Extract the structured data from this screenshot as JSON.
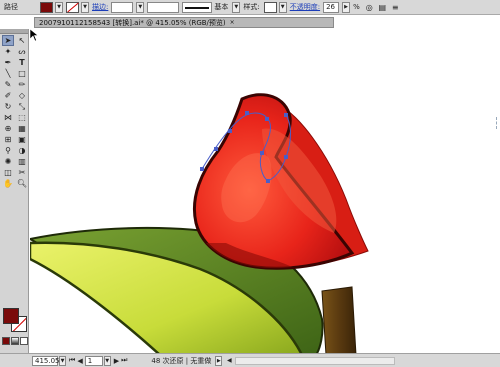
{
  "control_bar": {
    "title": "路径",
    "stroke_link": "描边:",
    "stroke_style": "基本",
    "style_label": "样式:",
    "opacity_link": "不透明度:",
    "opacity_value": "26",
    "opacity_unit": "%"
  },
  "document": {
    "tab_title": "2007910112158543 [转换].ai* @ 415.05% (RGB/预览)",
    "close_glyph": "×"
  },
  "status_bar": {
    "zoom": "415.05%",
    "page": "1",
    "status_text": "48 次还原 | 无重做"
  },
  "colors": {
    "fill": "#7a0a0a",
    "stroke_none": "#d20000",
    "petal": "#e8241a",
    "leaf": "#c8dc3a",
    "leaf_shadow": "#5a7a1e",
    "stem": "#5a3a10"
  },
  "tools": [
    "selection-tool-icon",
    "direct-selection-tool-icon",
    "magic-wand-tool-icon",
    "lasso-tool-icon",
    "pen-tool-icon",
    "type-tool-icon",
    "line-tool-icon",
    "rectangle-tool-icon",
    "paintbrush-tool-icon",
    "pencil-tool-icon",
    "blob-brush-tool-icon",
    "eraser-tool-icon",
    "rotate-tool-icon",
    "scale-tool-icon",
    "width-tool-icon",
    "free-transform-tool-icon",
    "shape-builder-tool-icon",
    "perspective-tool-icon",
    "mesh-tool-icon",
    "gradient-tool-icon",
    "eyedropper-tool-icon",
    "blend-tool-icon",
    "symbol-sprayer-tool-icon",
    "column-graph-tool-icon",
    "artboard-tool-icon",
    "slice-tool-icon",
    "hand-tool-icon",
    "zoom-tool-icon"
  ]
}
